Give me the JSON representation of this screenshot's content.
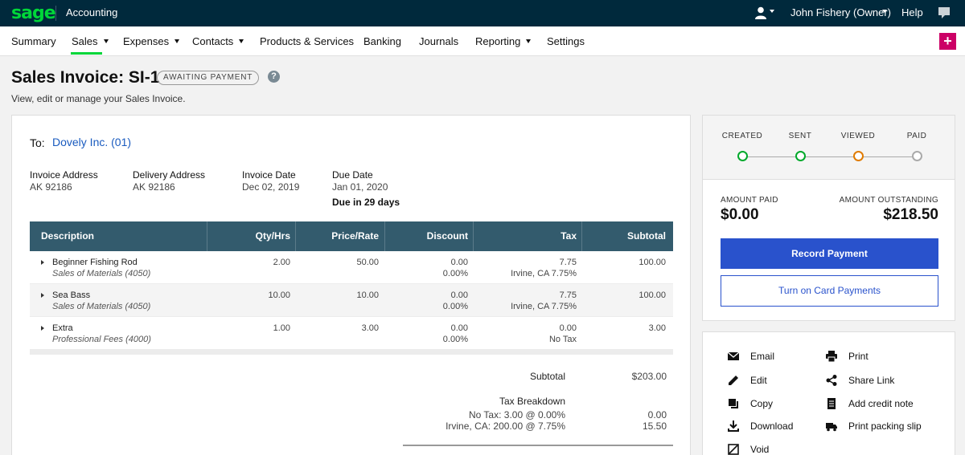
{
  "topbar": {
    "logo": "sage",
    "app_name": "Accounting",
    "user_name": "John Fishery (Owner)",
    "help": "Help"
  },
  "nav": {
    "items": [
      "Summary",
      "Sales",
      "Expenses",
      "Contacts",
      "Products & Services",
      "Banking",
      "Journals",
      "Reporting",
      "Settings"
    ],
    "add": "+"
  },
  "header": {
    "title": "Sales Invoice: SI-1",
    "status": "AWAITING PAYMENT",
    "help_glyph": "?",
    "subtitle": "View, edit or manage your Sales Invoice."
  },
  "invoice": {
    "to_label": "To:",
    "to_name": "Dovely Inc. (01)",
    "meta": [
      {
        "label": "Invoice Address",
        "value": "AK 92186"
      },
      {
        "label": "Delivery Address",
        "value": "AK 92186"
      },
      {
        "label": "Invoice Date",
        "value": "Dec 02, 2019"
      },
      {
        "label": "Due Date",
        "value": "Jan 01, 2020"
      }
    ],
    "due_in": "Due in 29 days",
    "columns": [
      "Description",
      "Qty/Hrs",
      "Price/Rate",
      "Discount",
      "Tax",
      "Subtotal"
    ],
    "rows": [
      {
        "name": "Beginner Fishing Rod",
        "ledger": "Sales of Materials (4050)",
        "qty": "2.00",
        "price": "50.00",
        "discount": "0.00",
        "discount_pct": "0.00%",
        "tax": "7.75",
        "tax_name": "Irvine, CA 7.75%",
        "subtotal": "100.00"
      },
      {
        "name": "Sea Bass",
        "ledger": "Sales of Materials (4050)",
        "qty": "10.00",
        "price": "10.00",
        "discount": "0.00",
        "discount_pct": "0.00%",
        "tax": "7.75",
        "tax_name": "Irvine, CA 7.75%",
        "subtotal": "100.00"
      },
      {
        "name": "Extra",
        "ledger": "Professional Fees (4000)",
        "qty": "1.00",
        "price": "3.00",
        "discount": "0.00",
        "discount_pct": "0.00%",
        "tax": "0.00",
        "tax_name": "No Tax",
        "subtotal": "3.00"
      }
    ],
    "totals": {
      "subtotal_label": "Subtotal",
      "subtotal_value": "$203.00",
      "tax_breakdown_label": "Tax Breakdown",
      "tax_lines": [
        {
          "label": "No Tax: 3.00 @ 0.00%",
          "value": "0.00"
        },
        {
          "label": "Irvine, CA: 200.00 @ 7.75%",
          "value": "15.50"
        }
      ]
    }
  },
  "status_panel": {
    "steps": [
      {
        "label": "CREATED",
        "color": "#00a92b"
      },
      {
        "label": "SENT",
        "color": "#00a92b"
      },
      {
        "label": "VIEWED",
        "color": "#e07b00"
      },
      {
        "label": "PAID",
        "color": "#aaaaaa"
      }
    ],
    "amount_paid_label": "AMOUNT PAID",
    "amount_paid": "$0.00",
    "amount_outstanding_label": "AMOUNT OUTSTANDING",
    "amount_outstanding": "$218.50",
    "record_payment": "Record Payment",
    "card_payments": "Turn on Card Payments"
  },
  "actions": {
    "email": "Email",
    "print": "Print",
    "edit": "Edit",
    "share_link": "Share Link",
    "copy": "Copy",
    "add_credit_note": "Add credit note",
    "download": "Download",
    "print_packing_slip": "Print packing slip",
    "void": "Void"
  },
  "colors": {
    "topbar": "#00293c",
    "brand_green": "#00d639",
    "primary_blue": "#2952cc",
    "table_header": "#335b6d",
    "add_button": "#cc0066"
  }
}
